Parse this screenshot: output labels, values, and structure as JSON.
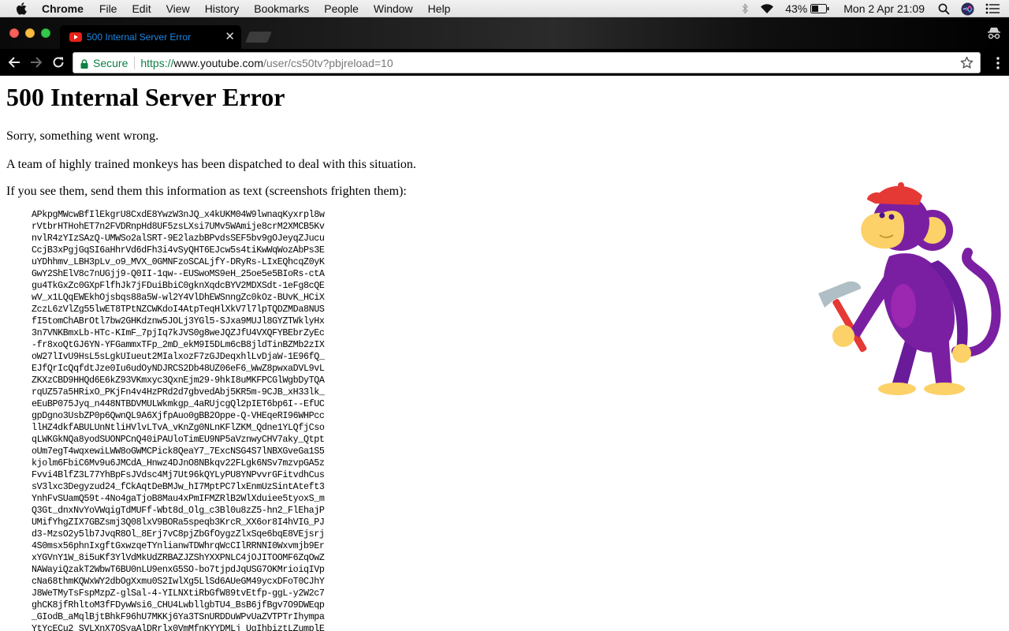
{
  "menubar": {
    "app": "Chrome",
    "items": [
      "File",
      "Edit",
      "View",
      "History",
      "Bookmarks",
      "People",
      "Window",
      "Help"
    ],
    "battery": "43%",
    "datetime": "Mon 2 Apr  21:09"
  },
  "tab": {
    "title": "500 Internal Server Error"
  },
  "omnibox": {
    "secure_label": "Secure",
    "scheme": "https://",
    "host": "www.youtube.com",
    "path": "/user/cs50tv?pbjreload=10"
  },
  "page": {
    "heading": "500 Internal Server Error",
    "p1": "Sorry, something went wrong.",
    "p2": "A team of highly trained monkeys has been dispatched to deal with this situation.",
    "p3": "If you see them, send them this information as text (screenshots frighten them):",
    "debug_lines": [
      "APkpgMWcwBfIlEkgrU8CxdE8YwzW3nJQ_x4kUKM04W9lwnaqKyxrpl8w",
      "rVtbrHTHohET7n2FVDRnpHd8UF5zsLXsi7UMv5WAmije8crM2XMCB5Kv",
      "nvlR4zYIzSAzQ-UMWSo2alSRT-9E2lazbBPvdsSEF5bv9gOJeyqZJucu",
      "CcjB3xPgjGqSI6aHhrVd6dFh3i4vSyQHT6EJcw5s4tiKwWqWozAbPs3E",
      "uYDhhmv_LBH3pLv_o9_MVX_0GMNFzoSCALjfY-DRyRs-LIxEQhcqZ0yK",
      "GwY2ShElV8c7nUGjj9-Q0II-1qw--EUSwoMS9eH_25oe5e5BIoRs-ctA",
      "gu4TkGxZc0GXpFlfhJk7jFDuiBbiC0gknXqdcBYV2MDXSdt-1eFg8cQE",
      "wV_x1LQqEWEkhOjsbqs88a5W-wl2Y4VlDhEWSnngZc0kOz-BUvK_HCiX",
      "ZczL6zVlZg55lwET8TPtNZCWKdoI4AtpTeqHlXkV7l7lpTQDZMDa8NUS",
      "fI5tomChABrOtl7bw2GHKdznw5JOLj3YGl5-SJxa9MUJl8GYZTWklyHx",
      "3n7VNKBmxLb-HTc-KImF_7pjIq7kJVS0g8weJQZJfU4VXQFYBEbrZyEc",
      "-fr8xoQtGJ6YN-YFGammxTFp_2mD_ekM9I5DLm6cB8jldTinBZMb2zIX",
      "oW27lIvU9HsL5sLgkUIueut2MIalxozF7zGJDeqxhlLvDjaW-1E96fQ_",
      "EJfQrIcQqfdtJze0Iu6udOyNDJRCS2Db48UZ06eF6_WwZ8pwxaDVL9vL",
      "ZKXzCBD9HHQd6E6kZ93VKmxyc3QxnEjm29-9hkI8uMKFPCGlWgbDyTQA",
      "rqUZ57a5HRixO_PKjFn4v4HzPRd2d7gbvedAbj5KR5m-9CJB_xH33lk_",
      "eEuBP075Jyq_n448NTBDVMULWkmkgp_4aRUjcgQl2pIET6bp6I--EfUC",
      "gpDgno3UsbZP0p6QwnQL9A6XjfpAuo0gBB2Oppe-Q-VHEqeRI96WHPcc",
      "llHZ4dkfABULUnNtliHVlvLTvA_vKnZg0NLnKFlZKM_Qdne1YLQfjCso",
      "qLWKGkNQa8yodSUONPCnQ40iPAUloTimEU9NP5aVznwyCHV7aky_Qtpt",
      "oUm7egT4wqxewiLWW8oGWMCPick8QeaY7_7ExcNSG4S7lNBXGveGa1S5",
      "kjolm6FbiC6Mv9u6JMCdA_Hnwz4DJnO8NBkqv22FLgk6NSv7mzvpGA5z",
      "Fvvi4BlfZ3L77YhBpFsJVdsc4Mj7Ut96kQYLyPU8YNPvvrGFitvdhCus",
      "sV3lxc3Degyzud24_fCkAqtDeBMJw_hI7MptPC7lxEnmUzSintAteft3",
      "YnhFvSUamQ59t-4No4gaTjoB8Mau4xPmIFMZRlB2WlXduiee5tyoxS_m",
      "Q3Gt_dnxNvYoVWqigTdMUFf-Wbt8d_Olg_c3Bl0u8zZ5-hn2_FlEhajP",
      "UMifYhgZIX7GBZsmj3Q08lxV9BORa5speqb3KrcR_XX6or8I4hVIG_PJ",
      "d3-MzsO2y5lb7JvqR8Ol_8Erj7vC8pjZbGfOygzZlxSqe6bqE8VEjsrj",
      "4S0msx56phnIxgftGxwzqeTYnlianwTDWhrqWcCIlRRNNI0Wxvmjb9Er",
      "xYGVnY1W_8i5uKf3YlVdMkUdZRBAZJZShYXXPNLC4jOJITOOMF6ZqOwZ",
      "NAWayiQzakT2WbwT6BU0nLU9enxG5SO-bo7tjpdJqUSG7OKMrioiqIVp",
      "cNa68thmKQWxWY2dbOgXxmu0S2IwlXg5LlSd6AUeGM49ycxDFoT0CJhY",
      "J8WeTMyTsFspMzpZ-glSal-4-YILNXtiRbGfW89tvEtfp-ggL-y2W2c7",
      "ghCK8jfRhltoM3fFDywWsi6_CHU4LwbllgbTU4_BsB6jfBgv7O9DWEqp",
      "_GIodB_aMqlBjtBhkF96hU7MKKj6Ya3TSnURDDuWPvUaZVTPTrIhympa",
      "YtYcECu2_SVLXnX7OSyaAlDRrlx0VmMfnKYYDMLj_UgIhbiztLZumplE"
    ]
  },
  "colors": {
    "tab_title": "#1e88e5",
    "secure_green": "#0b8043",
    "monkey_purple": "#7b1fa2",
    "monkey_face": "#fcd167",
    "hat_red": "#e53935"
  },
  "icons": [
    "apple-icon",
    "bluetooth-icon",
    "wifi-icon",
    "battery-icon",
    "spotlight-icon",
    "siri-icon",
    "notification-center-icon",
    "youtube-favicon",
    "close-tab-icon",
    "incognito-icon",
    "back-arrow-icon",
    "forward-arrow-icon",
    "reload-icon",
    "lock-icon",
    "bookmark-star-icon",
    "chrome-menu-icon",
    "monkey-illustration"
  ]
}
